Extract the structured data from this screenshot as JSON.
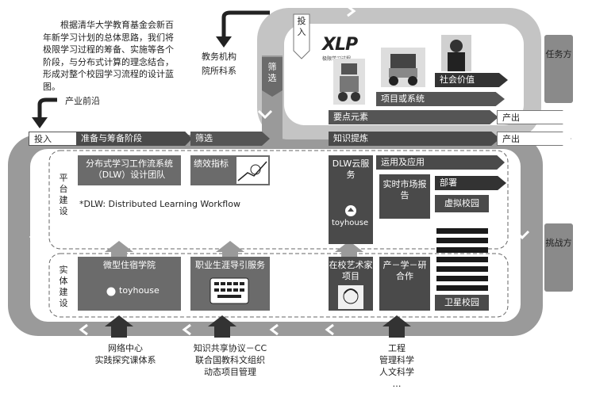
{
  "intro_text": "根据清华大学教育基金会新百年新学习计划的总体思路，我们将极限学习过程的筹备、实施等各个阶段，与分布式计算的理念结合，形成对整个校园学习流程的设计蓝图。",
  "top": {
    "industry_label": "产业前沿",
    "edu_inst_line1": "教务机构",
    "edu_inst_line2": "院所科系",
    "touru_top": "投入",
    "shaixuan_vertical": "筛选",
    "xlp_logo": "XLP",
    "xlp_sub": "极限学习过程",
    "social_value": "社会价值",
    "project_system": "项目或系统",
    "key_elements": "要点元素",
    "output_top": "产出"
  },
  "flow": {
    "input": "投入",
    "prepare": "准备与筹备阶段",
    "screen": "筛选",
    "refine": "知识提炼",
    "output": "产出"
  },
  "platform": {
    "side_label": "平台建设",
    "dlw_team": "分布式学习工作流系统（DLW）设计团队",
    "kpi": "绩效指标",
    "dlw_note": "*DLW: Distributed Learning Workflow",
    "dlw_cloud": "DLW云服务",
    "toyhouse": "toyhouse",
    "apply": "运用及应用",
    "market_report": "实时市场报告",
    "deploy": "部署",
    "virtual_campus": "虚拟校园"
  },
  "entity": {
    "side_label": "实体建设",
    "micro_college": "微型住宿学院",
    "toyhouse": "toyhouse",
    "career": "职业生涯导引服务",
    "artist": "在校艺术家项目",
    "industry_research": "产－学－研合作",
    "satellite": "卫星校园"
  },
  "right": {
    "task": "任务方",
    "challenge": "挑战方"
  },
  "bottom": {
    "col1": [
      "网络中心",
      "实践探究课体系"
    ],
    "col2": [
      "知识共享协议－CC",
      "联合国教科文组织",
      "动态项目管理"
    ],
    "col3": [
      "工程",
      "管理科学",
      "人文科学",
      "…"
    ]
  },
  "colors": {
    "ring_outer": "#9a9a9a",
    "ring_top": "#bdbdbd",
    "dark_bar": "#4a4a4a",
    "mid_bar": "#6b6b6b"
  }
}
